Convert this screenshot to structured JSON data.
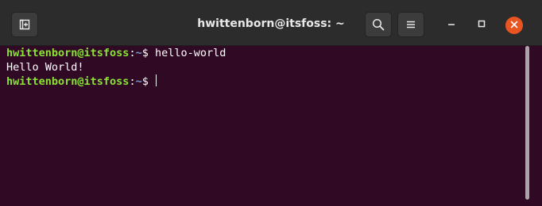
{
  "window": {
    "title": "hwittenborn@itsfoss: ~",
    "accent_color": "#e95420",
    "background_color": "#300a24"
  },
  "titlebar": {
    "new_tab_icon": "new-tab-icon",
    "search_icon": "search-icon",
    "menu_icon": "hamburger-menu-icon",
    "minimize_icon": "minimize-icon",
    "maximize_icon": "maximize-icon",
    "close_icon": "close-icon"
  },
  "terminal": {
    "lines": [
      {
        "user_host": "hwittenborn@itsfoss",
        "sep": ":",
        "path": "~",
        "prompt": "$ ",
        "command": "hello-world"
      },
      {
        "output": "Hello World!"
      },
      {
        "user_host": "hwittenborn@itsfoss",
        "sep": ":",
        "path": "~",
        "prompt": "$ ",
        "command": ""
      }
    ]
  }
}
